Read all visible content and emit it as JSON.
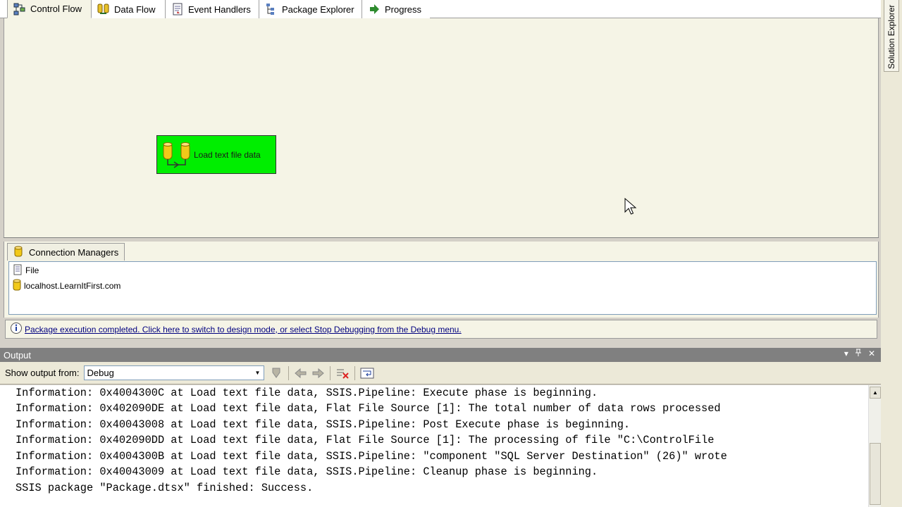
{
  "tabs": [
    {
      "label": "Control Flow",
      "icon": "control-flow-icon",
      "active": true
    },
    {
      "label": "Data Flow",
      "icon": "data-flow-icon",
      "active": false
    },
    {
      "label": "Event Handlers",
      "icon": "event-handlers-icon",
      "active": false
    },
    {
      "label": "Package Explorer",
      "icon": "package-explorer-icon",
      "active": false
    },
    {
      "label": "Progress",
      "icon": "progress-arrow-icon",
      "active": false
    }
  ],
  "task": {
    "label": "Load text file data",
    "color": "#00ee00"
  },
  "connection_managers": {
    "title": "Connection Managers",
    "items": [
      {
        "label": "File",
        "icon": "flat-file-icon"
      },
      {
        "label": "localhost.LearnItFirst.com",
        "icon": "database-icon"
      }
    ]
  },
  "status": {
    "message": "Package execution completed. Click here to switch to design mode, or select Stop Debugging from the Debug menu."
  },
  "output": {
    "title": "Output",
    "show_from_label": "Show output from:",
    "source": "Debug",
    "lines": [
      "Information: 0x4004300C at Load text file data, SSIS.Pipeline: Execute phase is beginning.",
      "Information: 0x402090DE at Load text file data, Flat File Source [1]: The total number of data rows processed",
      "Information: 0x40043008 at Load text file data, SSIS.Pipeline: Post Execute phase is beginning.",
      "Information: 0x402090DD at Load text file data, Flat File Source [1]: The processing of file \"C:\\ControlFile",
      "Information: 0x4004300B at Load text file data, SSIS.Pipeline: \"component \"SQL Server Destination\" (26)\" wrote",
      "Information: 0x40043009 at Load text file data, SSIS.Pipeline: Cleanup phase is beginning.",
      "SSIS package \"Package.dtsx\" finished: Success."
    ]
  },
  "solution_explorer": {
    "label": "Solution Explorer"
  }
}
